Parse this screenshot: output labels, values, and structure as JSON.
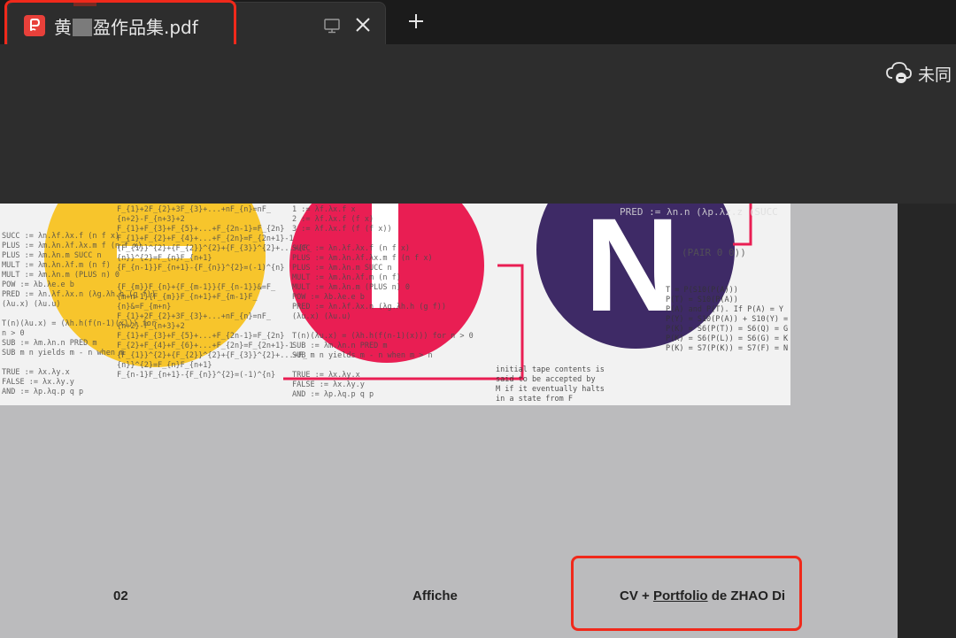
{
  "tab": {
    "title_prefix": "黄",
    "title_suffix": "盈作品集.pdf"
  },
  "new_tab_label": "+",
  "sync_status": "未同",
  "poster": {
    "letter_n": "N",
    "formulas_left": "SUCC := λn.λf.λx.f (n f x)\nPLUS := λm.λn.λf.λx.m f (n f x)\nPLUS := λm.λn.m SUCC n\nMULT := λm.λn.λf.m (n f)\nMULT := λm.λn.m (PLUS n) 0\nPOW := λb.λe.e b\nPRED := λn.λf.λx.n (λg.λh.h (g f))\n(λu.x) (λu.u)\n\nT(n)(λu.x) = (λh.h(f(n-1)(x))) for\nn > 0\nSUB := λm.λn.n PRED m\nSUB m n yields m - n when m\n\nTRUE := λx.λy.x\nFALSE := λx.λy.y\nAND := λp.λq.p q p",
    "formulas_mid": "F_{1}+2F_{2}+3F_{3}+...+nF_{n}=nF_\n{n+2}-F_{n+3}+2\nF_{1}+F_{3}+F_{5}+...+F_{2n-1}=F_{2n}\nF_{1}+F_{2}+F_{4}+...+F_{2n}=F_{2n+1}-1\n{F_{1}}^{2}+{F_{2}}^{2}+{F_{3}}^{2}+...+{F_\n{n}}^{2}=F_{n}F_{n+1}\n{F_{n-1}}F_{n+1}-{F_{n}}^{2}=(-1)^{n}\n\n{F_{m}}F_{n}+{F_{m-1}}{F_{n-1}}&=F_\n{m+n-1}{F_{m}}F_{n+1}+F_{m-1}F_\n{n}&=F_{m+n}\nF_{1}+2F_{2}+3F_{3}+...+nF_{n}=nF_\n{n+2}-F_{n+3}+2\nF_{1}+F_{3}+F_{5}+...+F_{2n-1}=F_{2n}\nF_{2}+F_{4}+F_{6}+...+F_{2n}=F_{2n+1}-1\n{F_{1}}^{2}+{F_{2}}^{2}+{F_{3}}^{2}+...+F_\n{n}}^{2}=F_{n}F_{n+1}\nF_{n-1}F_{n+1}-{F_{n}}^{2}=(-1)^{n}",
    "formulas_center": "1 := λf.λx.f x\n2 := λf.λx.f (f x)\n3 := λf.λx.f (f (f x))\n\nSUCC := λn.λf.λx.f (n f x)\nPLUS := λm.λn.λf.λx.m f (n f x)\nPLUS := λm.λn.m SUCC n\nMULT := λm.λn.λf.m (n f)\nMULT := λm.λn.m (PLUS n) 0\nPOW := λb.λe.e b\nPRED := λn.λf.λx.n (λg.λh.h (g f))\n(λu.x) (λu.u)\n\nT(n)(λu.x) = (λh.h(f(n-1)(x))) for n > 0\nSUB := λm.λn.n PRED m\nSUB m n yields m - n when m > n\n\nTRUE := λx.λy.x\nFALSE := λx.λy.y\nAND := λp.λq.p q p",
    "formulas_right": "T = P(S10(P(A)))\nP(T) = S10(P(A))\nP(A) and P(T). If P(A) = Y\nP(Y) = S10(P(A)) + S10(Y) = Q\nP(K) = S6(P(T)) = S6(Q) = G\nP(K) = S6(P(L)) = S6(G) = K\nP(K) = S7(P(K)) = S7(F) = N",
    "turing_note": "initial tape contents is\nsaid to be accepted by\nM if it eventually halts\nin a state from F",
    "pred_text": "PRED := λn.n (λp.λz.z (SUCC",
    "pair_text": "(PAIR 0 0))"
  },
  "footer": {
    "page_number": "02",
    "section": "Affiche",
    "credit_prefix": "CV + ",
    "credit_link": "Portfolio",
    "credit_suffix": " de ZHAO Di"
  },
  "colors": {
    "yellow_circle": "#f7c52c",
    "pink_circle": "#e91e53",
    "purple_circle": "#3e2a66",
    "highlight": "#f0291b"
  }
}
